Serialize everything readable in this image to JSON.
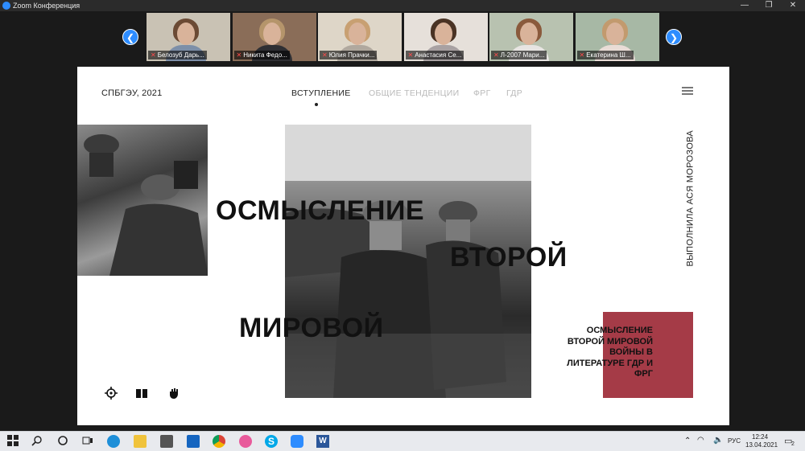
{
  "window": {
    "title": "Zoom Конференция",
    "minimize": "—",
    "maximize": "❐",
    "close": "✕"
  },
  "participants": [
    {
      "name": "Белозуб Дарь...",
      "hair": "#6b4a34",
      "shirt": "#7d8fa8",
      "bg": "#c9c2b4"
    },
    {
      "name": "Никита Федо...",
      "hair": "#b5956b",
      "shirt": "#2f2f33",
      "bg": "#8a6d58"
    },
    {
      "name": "Юлия Прачки...",
      "hair": "#c8a072",
      "shirt": "#b0a89e",
      "bg": "#ded6c8"
    },
    {
      "name": "Анастасия Се...",
      "hair": "#4a3324",
      "shirt": "#a8a1a2",
      "bg": "#e6e0da"
    },
    {
      "name": "Л-2007 Мари...",
      "hair": "#8a5a3c",
      "shirt": "#e7e4e2",
      "bg": "#b8c2b0"
    },
    {
      "name": "Екатерина Ш...",
      "hair": "#c29a6e",
      "shirt": "#e9dcd6",
      "bg": "#a7b8a5"
    }
  ],
  "slide": {
    "brand": "СПБГЭУ, 2021",
    "nav": [
      {
        "label": "ВСТУПЛЕНИЕ",
        "active": true
      },
      {
        "label": "ОБЩИЕ ТЕНДЕНЦИИ",
        "active": false
      },
      {
        "label": "ФРГ",
        "active": false
      },
      {
        "label": "ГДР",
        "active": false
      }
    ],
    "title_words": [
      "ОСМЫСЛЕНИЕ",
      "ВТОРОЙ",
      "МИРОВОЙ"
    ],
    "author": "ВЫПОЛНИЛА АСЯ МОРОЗОВА",
    "subtitle": "ОСМЫСЛЕНИЕ ВТОРОЙ МИРОВОЙ ВОЙНЫ В ЛИТЕРАТУРЕ ГДР И ФРГ",
    "accent": "#a53b47"
  },
  "taskbar": {
    "lang": "РУС",
    "time": "12:24",
    "date": "13.04.2021",
    "notifications": "2"
  }
}
